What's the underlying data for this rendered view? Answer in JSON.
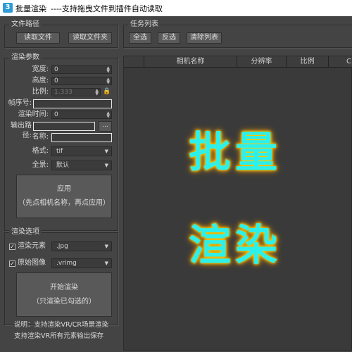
{
  "window": {
    "icon_glyph": "3",
    "title": "批量渲染",
    "subtitle": "----支持拖曳文件到插件自动读取"
  },
  "file_path": {
    "group_title": "文件路径",
    "read_file": "读取文件",
    "read_folder": "读取文件夹"
  },
  "task_list": {
    "group_title": "任务列表",
    "select_all": "全选",
    "invert": "反选",
    "clear": "清除列表",
    "columns": [
      "",
      "相机名称",
      "分辨率",
      "比例",
      "C"
    ]
  },
  "render_params": {
    "group_title": "渲染参数",
    "width_label": "宽度:",
    "width_value": "0",
    "height_label": "高度:",
    "height_value": "0",
    "ratio_label": "比例:",
    "ratio_value": "1.333",
    "frame_label": "帧序号:",
    "frame_value": "",
    "time_label": "渲染时间:",
    "time_value": "0",
    "output_label": "输出路径:",
    "output_value": "",
    "browse_label": "...",
    "name_label": "名称:",
    "name_value": "",
    "format_label": "格式:",
    "format_value": "tif",
    "fullscreen_label": "全景:",
    "fullscreen_value": "默认",
    "apply_line1": "应用",
    "apply_line2": "（先点相机名称，再点应用）"
  },
  "render_options": {
    "group_title": "渲染选项",
    "elements_label": "渲染元素",
    "elements_checked": true,
    "elements_format": ".jpg",
    "raw_label": "原始图像",
    "raw_checked": true,
    "raw_format": ".vrimg",
    "start_line1": "开始渲染",
    "start_line2": "（只渲染已勾选的）"
  },
  "notes": {
    "line1": "说明：支持渲染VR/CR场景渲染",
    "line2": "支持渲染VR所有元素输出保存"
  },
  "overlay": {
    "line1": "批量",
    "line2": "渲染"
  },
  "colors": {
    "background": "#444444",
    "glow_text": "#2ef0ea",
    "glow_outline": "#ffb800"
  }
}
